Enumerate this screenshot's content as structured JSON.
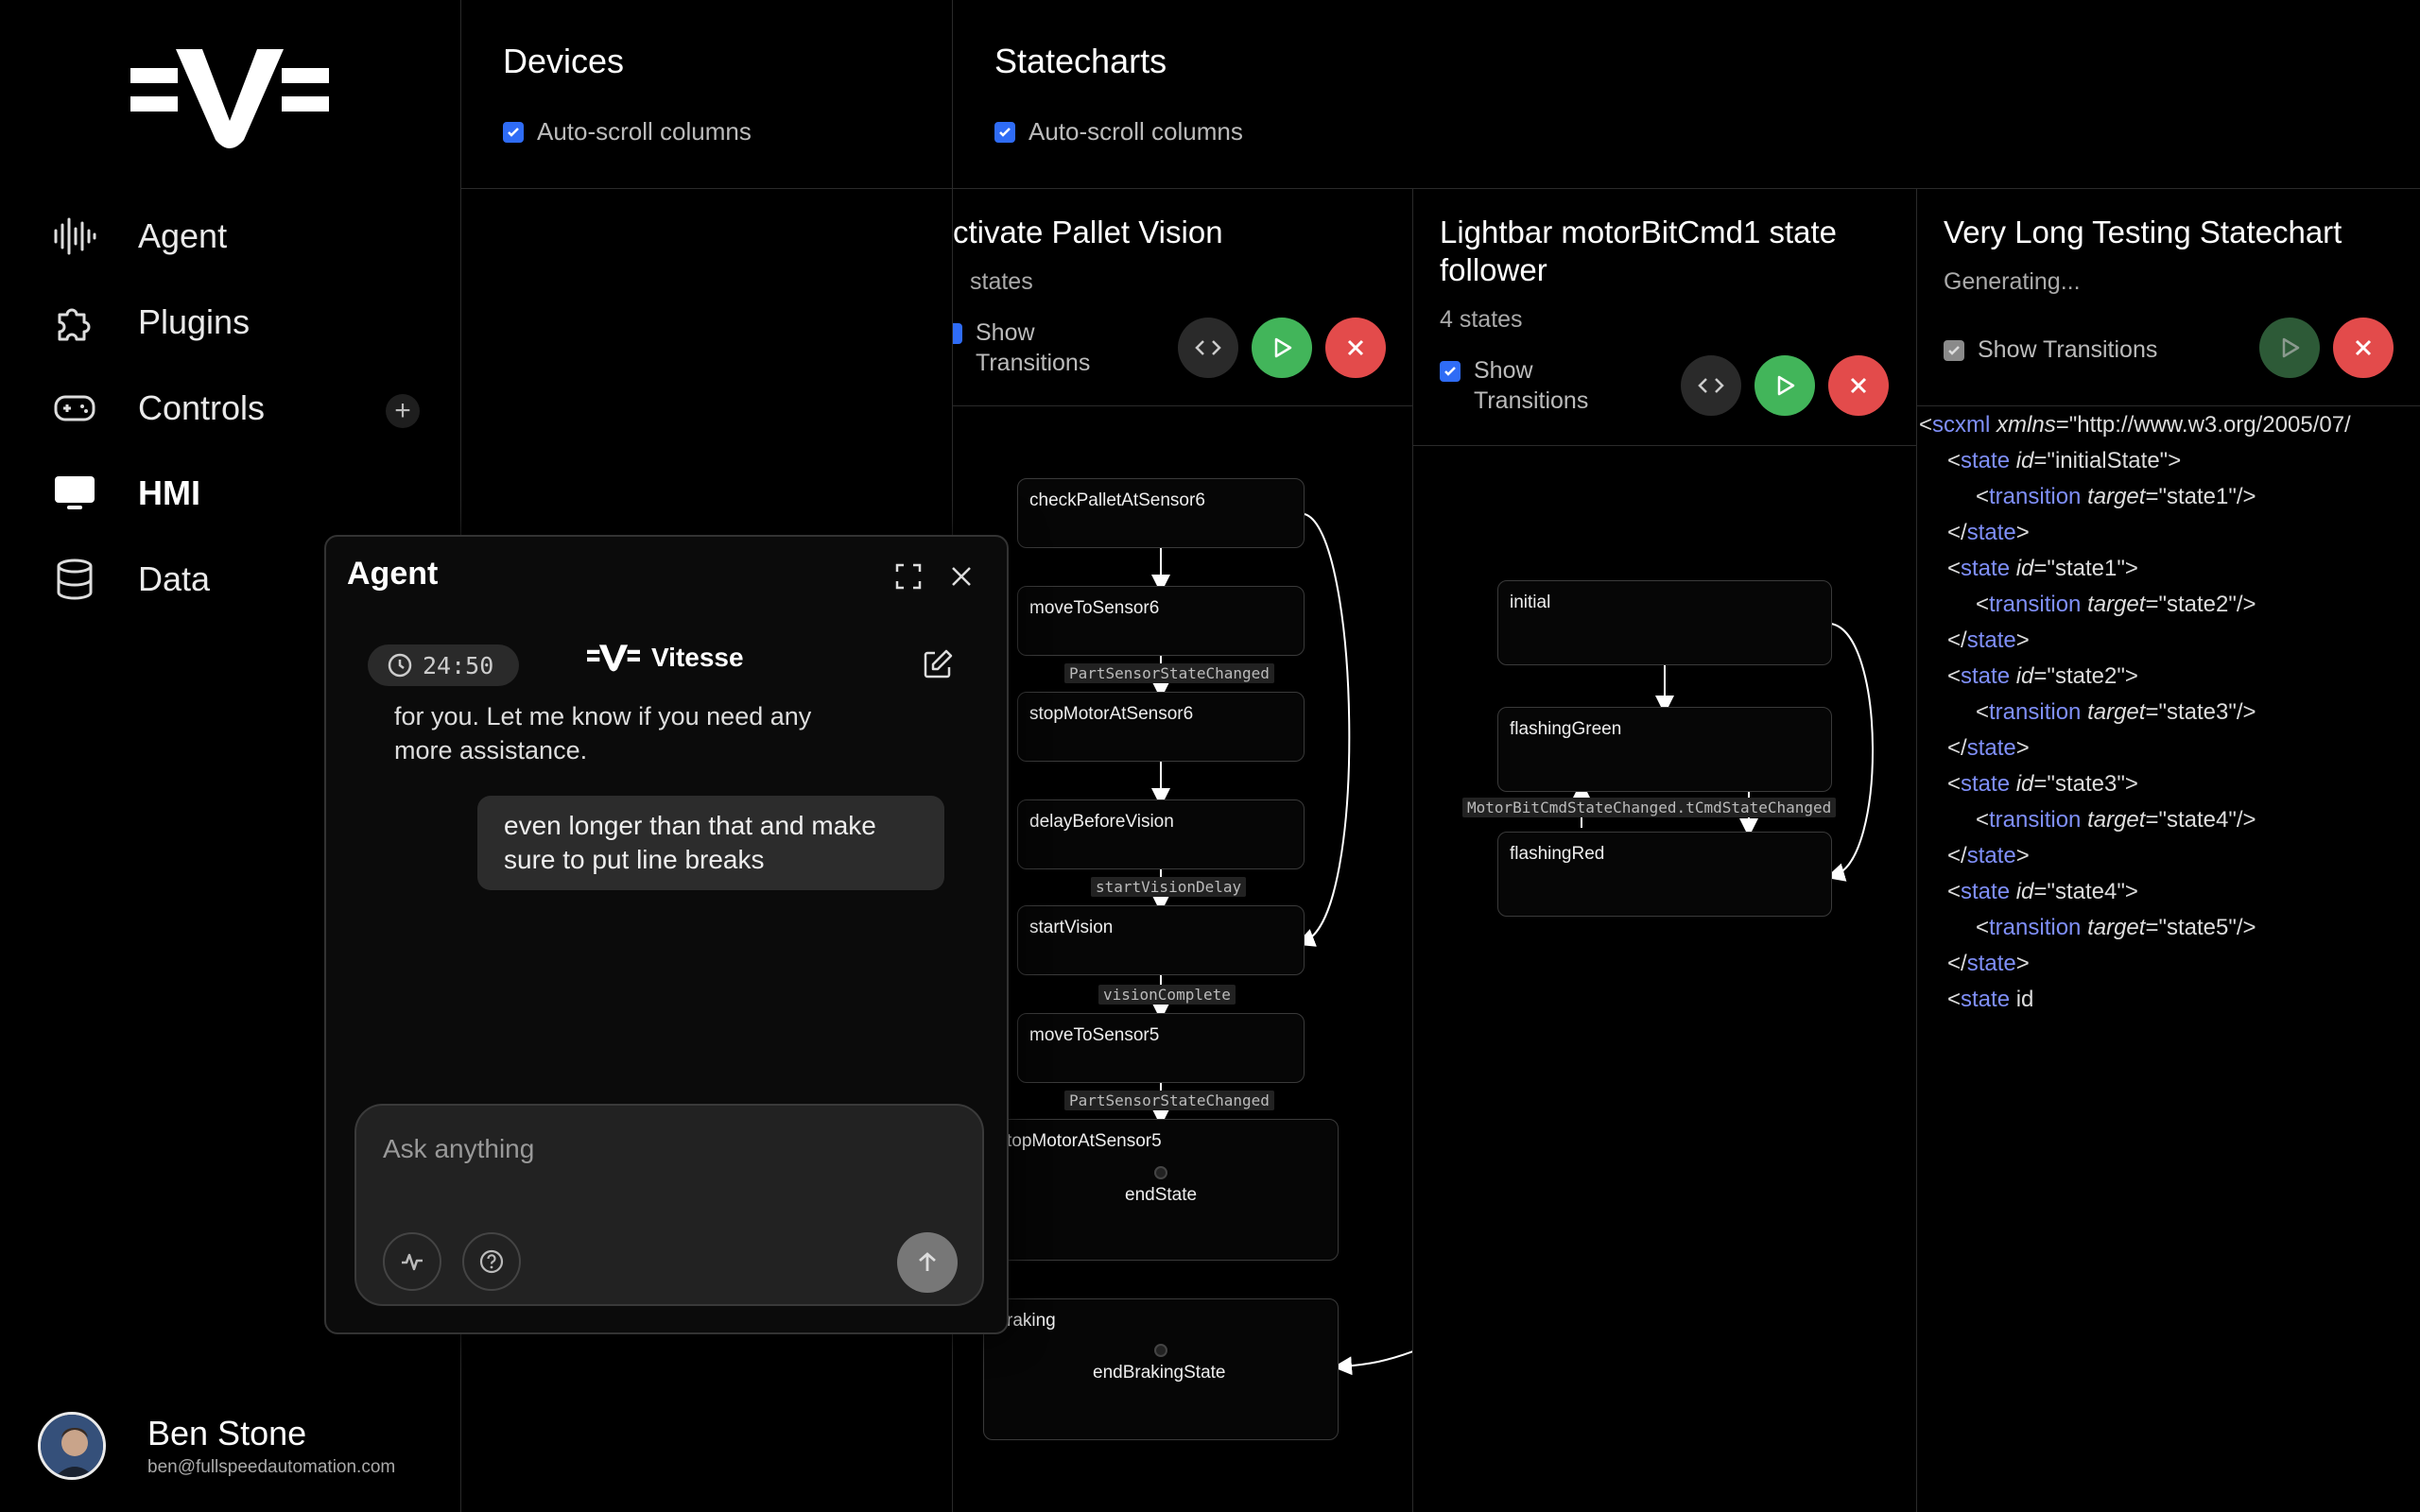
{
  "sidebar": {
    "items": [
      {
        "label": "Agent",
        "icon": "waveform-icon"
      },
      {
        "label": "Plugins",
        "icon": "puzzle-icon"
      },
      {
        "label": "Controls",
        "icon": "gamepad-icon"
      },
      {
        "label": "HMI",
        "icon": "monitor-icon"
      },
      {
        "label": "Data",
        "icon": "database-icon"
      }
    ],
    "controls_add": "+",
    "user": {
      "name": "Ben Stone",
      "email": "ben@fullspeedautomation.com"
    }
  },
  "devices": {
    "title": "Devices",
    "autoscroll_label": "Auto-scroll columns"
  },
  "statecharts": {
    "title": "Statecharts",
    "autoscroll_label": "Auto-scroll columns"
  },
  "columns": {
    "pallet": {
      "title": "ctivate Pallet Vision",
      "sub": "states",
      "show_transitions": "Show Transitions",
      "states": [
        "checkPalletAtSensor6",
        "moveToSensor6",
        "stopMotorAtSensor6",
        "delayBeforeVision",
        "startVision",
        "moveToSensor5",
        "topMotorAtSensor5",
        "endState",
        "raking",
        "endBrakingState"
      ],
      "edge_labels": [
        "PartSensorStateChanged",
        "startVisionDelay",
        "visionComplete",
        "PartSensorStateChanged"
      ]
    },
    "lightbar": {
      "title": "Lightbar motorBitCmd1 state follower",
      "sub": "4 states",
      "show_transitions": "Show Transitions",
      "states": [
        "initial",
        "flashingGreen",
        "flashingRed"
      ],
      "edge_label": "MotorBitCmdStateChanged.tCmdStateChanged"
    },
    "verylong": {
      "title": "Very Long Testing Statechart",
      "sub": "Generating...",
      "show_transitions": "Show Transitions",
      "code": {
        "scxml_tag": "scxml",
        "xmlns_attr": "xmlns",
        "xmlns_val": "\"http://www.w3.org/2005/07/",
        "states": [
          {
            "id": "\"initialState\"",
            "target": "\"state1\""
          },
          {
            "id": "\"state1\"",
            "target": "\"state2\""
          },
          {
            "id": "\"state2\"",
            "target": "\"state3\""
          },
          {
            "id": "\"state3\"",
            "target": "\"state4\""
          },
          {
            "id": "\"state4\"",
            "target": "\"state5\""
          }
        ],
        "state_tag": "state",
        "transition_tag": "transition",
        "id_attr": "id",
        "target_attr": "target",
        "last_partial": "id"
      }
    }
  },
  "agent": {
    "title": "Agent",
    "timer": "24:50",
    "brand": "Vitesse",
    "partial_message": "for you. Let me know if you need any more assistance.",
    "user_message": "even longer than that and make sure to put line breaks",
    "input_placeholder": "Ask anything"
  },
  "colors": {
    "accent": "#2f6cf6",
    "play": "#42b55a",
    "stop": "#e34b4b",
    "code_tag": "#7f8ff8"
  }
}
